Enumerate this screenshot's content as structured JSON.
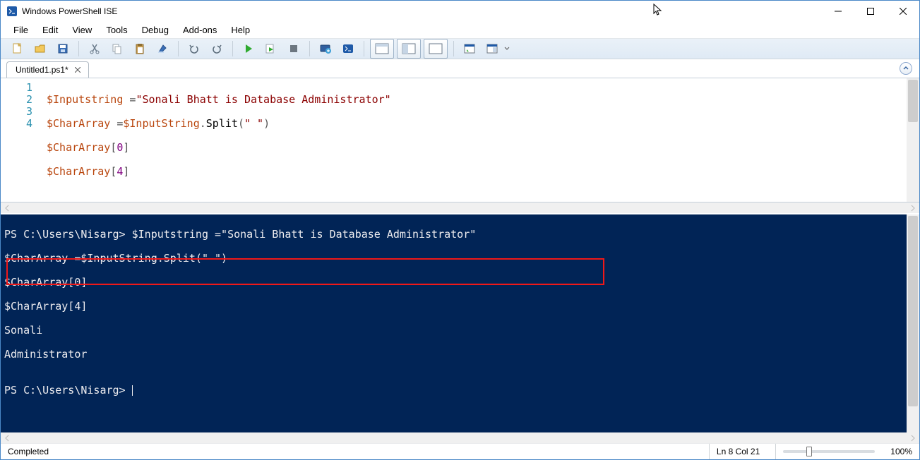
{
  "window": {
    "title": "Windows PowerShell ISE"
  },
  "menu": {
    "file": "File",
    "edit": "Edit",
    "view": "View",
    "tools": "Tools",
    "debug": "Debug",
    "addons": "Add-ons",
    "help": "Help"
  },
  "tab": {
    "label": "Untitled1.ps1*"
  },
  "gutter": [
    "1",
    "2",
    "3",
    "4"
  ],
  "code": {
    "l1": {
      "v1": "$Inputstring ",
      "op": "=",
      "str": "\"Sonali Bhatt is Database Administrator\""
    },
    "l2": {
      "v1": "$CharArray ",
      "op": "=",
      "v2": "$InputString",
      "dot": ".",
      "m": "Split",
      "p1": "(",
      "str": "\" \"",
      "p2": ")"
    },
    "l3": {
      "v1": "$CharArray",
      "b1": "[",
      "n": "0",
      "b2": "]"
    },
    "l4": {
      "v1": "$CharArray",
      "b1": "[",
      "n": "4",
      "b2": "]"
    }
  },
  "console": {
    "line1": "PS C:\\Users\\Nisarg> $Inputstring =\"Sonali Bhatt is Database Administrator\"",
    "line2": "$CharArray =$InputString.Split(\" \")",
    "line3": "$CharArray[0]",
    "line4": "$CharArray[4]",
    "out1": "Sonali",
    "out2": "Administrator",
    "blank": "",
    "prompt": "PS C:\\Users\\Nisarg> "
  },
  "status": {
    "text": "Completed",
    "pos": "Ln 8  Col 21",
    "zoom": "100%"
  }
}
